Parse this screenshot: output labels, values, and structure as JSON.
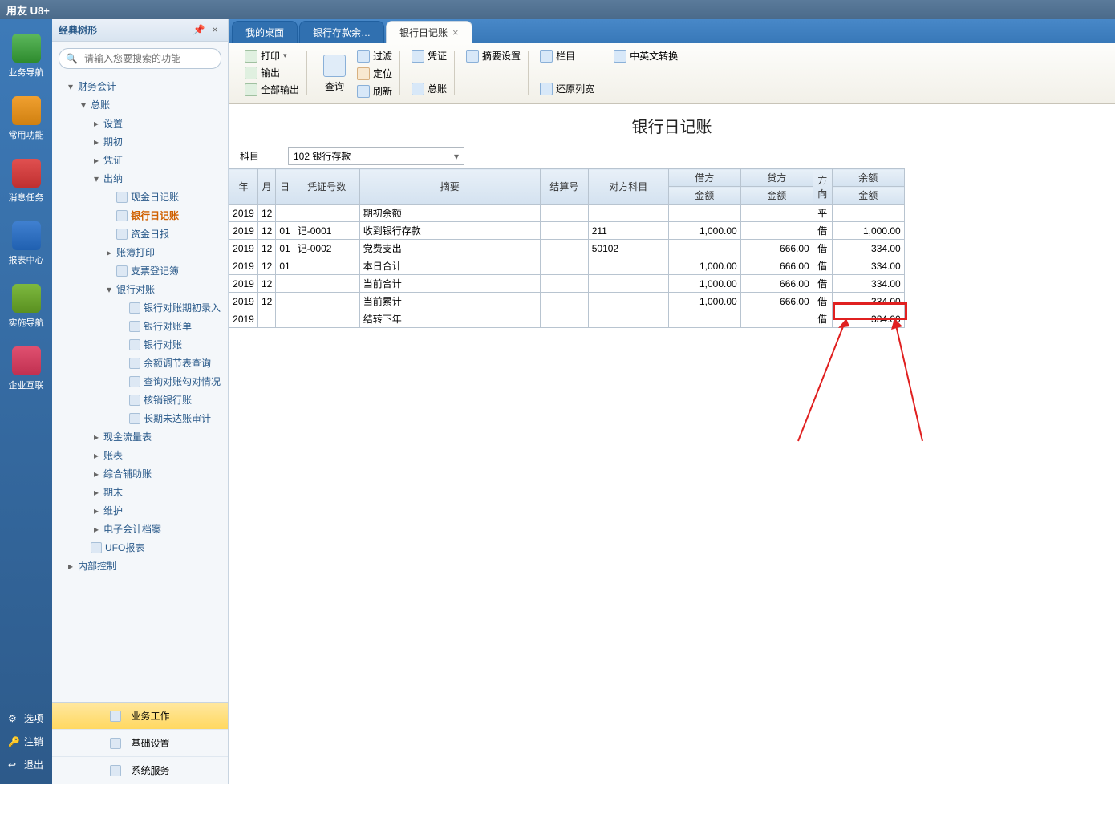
{
  "app_title": "用友 U8+",
  "iconbar": [
    {
      "label": "业务导航",
      "cls": "ic-green"
    },
    {
      "label": "常用功能",
      "cls": "ic-orange"
    },
    {
      "label": "消息任务",
      "cls": "ic-red"
    },
    {
      "label": "报表中心",
      "cls": "ic-blue"
    },
    {
      "label": "实施导航",
      "cls": "ic-lgreen"
    },
    {
      "label": "企业互联",
      "cls": "ic-pink"
    }
  ],
  "iconbar_bottom": [
    "选项",
    "注销",
    "退出"
  ],
  "tree_title": "经典树形",
  "search_placeholder": "请输入您要搜索的功能",
  "tree": [
    {
      "t": "财务会计",
      "lvl": 1,
      "arrow": "▾"
    },
    {
      "t": "总账",
      "lvl": 2,
      "arrow": "▾"
    },
    {
      "t": "设置",
      "lvl": 3,
      "arrow": "▸"
    },
    {
      "t": "期初",
      "lvl": 3,
      "arrow": "▸"
    },
    {
      "t": "凭证",
      "lvl": 3,
      "arrow": "▸"
    },
    {
      "t": "出纳",
      "lvl": 3,
      "arrow": "▾"
    },
    {
      "t": "现金日记账",
      "lvl": 4,
      "leaf": true
    },
    {
      "t": "银行日记账",
      "lvl": 4,
      "leaf": true,
      "sel": true
    },
    {
      "t": "资金日报",
      "lvl": 4,
      "leaf": true
    },
    {
      "t": "账簿打印",
      "lvl": 4,
      "arrow": "▸"
    },
    {
      "t": "支票登记簿",
      "lvl": 4,
      "leaf": true
    },
    {
      "t": "银行对账",
      "lvl": 4,
      "arrow": "▾"
    },
    {
      "t": "银行对账期初录入",
      "lvl": 5,
      "leaf": true
    },
    {
      "t": "银行对账单",
      "lvl": 5,
      "leaf": true
    },
    {
      "t": "银行对账",
      "lvl": 5,
      "leaf": true
    },
    {
      "t": "余额调节表查询",
      "lvl": 5,
      "leaf": true
    },
    {
      "t": "查询对账勾对情况",
      "lvl": 5,
      "leaf": true
    },
    {
      "t": "核销银行账",
      "lvl": 5,
      "leaf": true
    },
    {
      "t": "长期未达账审计",
      "lvl": 5,
      "leaf": true
    },
    {
      "t": "现金流量表",
      "lvl": 3,
      "arrow": "▸"
    },
    {
      "t": "账表",
      "lvl": 3,
      "arrow": "▸"
    },
    {
      "t": "综合辅助账",
      "lvl": 3,
      "arrow": "▸"
    },
    {
      "t": "期末",
      "lvl": 3,
      "arrow": "▸"
    },
    {
      "t": "维护",
      "lvl": 3,
      "arrow": "▸"
    },
    {
      "t": "电子会计档案",
      "lvl": 3,
      "arrow": "▸"
    },
    {
      "t": "UFO报表",
      "lvl": 2,
      "leaf": true
    },
    {
      "t": "内部控制",
      "lvl": 1,
      "arrow": "▸"
    }
  ],
  "tree_bottom": [
    "业务工作",
    "基础设置",
    "系统服务"
  ],
  "tabs": [
    {
      "label": "我的桌面",
      "active": false
    },
    {
      "label": "银行存款余…",
      "active": false
    },
    {
      "label": "银行日记账",
      "active": true
    }
  ],
  "toolbar": {
    "print": "打印",
    "export": "输出",
    "export_all": "全部输出",
    "query": "查询",
    "filter": "过滤",
    "locate": "定位",
    "refresh": "刷新",
    "voucher": "凭证",
    "summary_set": "摘要设置",
    "gl": "总账",
    "column": "栏目",
    "restore_width": "还原列宽",
    "lang": "中英文转换"
  },
  "page_title": "银行日记账",
  "filter": {
    "label": "科目",
    "value": "102 银行存款"
  },
  "grid_headers": {
    "year": "年",
    "month": "月",
    "day": "日",
    "voucher": "凭证号数",
    "summary": "摘要",
    "settle": "结算号",
    "opp": "对方科目",
    "debit": "借方",
    "credit": "贷方",
    "amount": "金额",
    "dir": "方向",
    "balance": "余额"
  },
  "rows": [
    {
      "y": "2019",
      "m": "12",
      "d": "",
      "v": "",
      "s": "期初余额",
      "st": "",
      "op": "",
      "db": "",
      "cr": "",
      "dir": "平",
      "bal": ""
    },
    {
      "y": "2019",
      "m": "12",
      "d": "01",
      "v": "记-0001",
      "s": "收到银行存款",
      "st": "",
      "op": "211",
      "db": "1,000.00",
      "cr": "",
      "dir": "借",
      "bal": "1,000.00"
    },
    {
      "y": "2019",
      "m": "12",
      "d": "01",
      "v": "记-0002",
      "s": "党费支出",
      "st": "",
      "op": "50102",
      "db": "",
      "cr": "666.00",
      "dir": "借",
      "bal": "334.00"
    },
    {
      "y": "2019",
      "m": "12",
      "d": "01",
      "v": "",
      "s": "本日合计",
      "st": "",
      "op": "",
      "db": "1,000.00",
      "cr": "666.00",
      "dir": "借",
      "bal": "334.00"
    },
    {
      "y": "2019",
      "m": "12",
      "d": "",
      "v": "",
      "s": "当前合计",
      "st": "",
      "op": "",
      "db": "1,000.00",
      "cr": "666.00",
      "dir": "借",
      "bal": "334.00"
    },
    {
      "y": "2019",
      "m": "12",
      "d": "",
      "v": "",
      "s": "当前累计",
      "st": "",
      "op": "",
      "db": "1,000.00",
      "cr": "666.00",
      "dir": "借",
      "bal": "334.00"
    },
    {
      "y": "2019",
      "m": "",
      "d": "",
      "v": "",
      "s": "结转下年",
      "st": "",
      "op": "",
      "db": "",
      "cr": "",
      "dir": "借",
      "bal": "334.00"
    }
  ]
}
